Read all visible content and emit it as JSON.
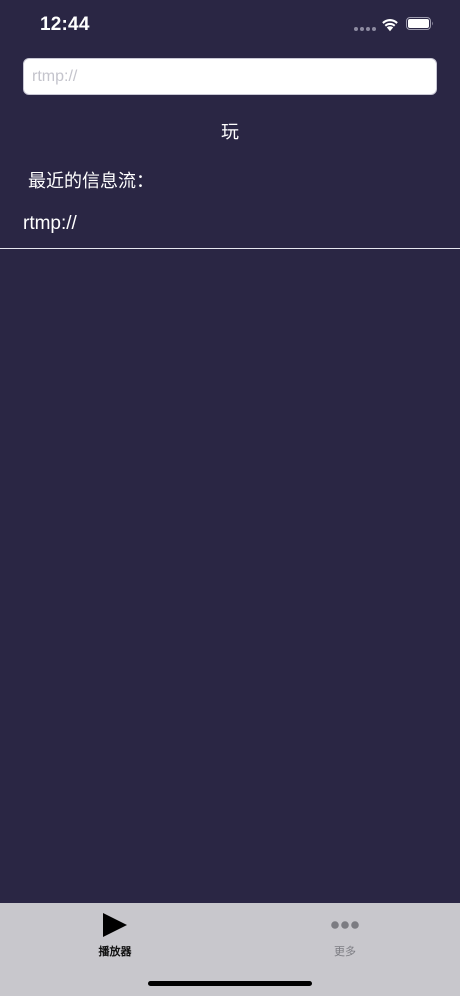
{
  "status_bar": {
    "time": "12:44"
  },
  "stream_input": {
    "value": "",
    "placeholder": "rtmp://"
  },
  "play_button": {
    "label": "玩"
  },
  "recent": {
    "label": "最近的信息流：",
    "items": [
      {
        "url": "rtmp://"
      }
    ]
  },
  "tab_bar": {
    "tabs": [
      {
        "label": "播放器",
        "icon": "play-icon",
        "selected": true
      },
      {
        "label": "更多",
        "icon": "more-icon",
        "selected": false
      }
    ]
  },
  "colors": {
    "background": "#2a2644",
    "tab_bar": "#c8c7cc",
    "text": "#ffffff"
  }
}
